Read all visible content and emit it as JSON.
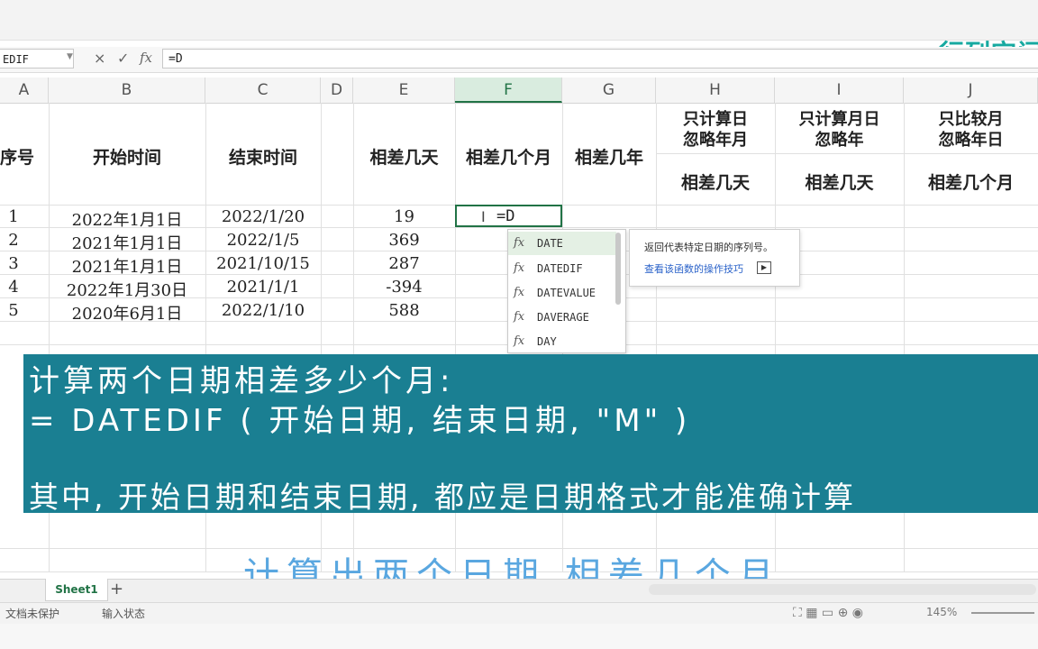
{
  "logo": {
    "text": "行列空间"
  },
  "formula_bar": {
    "name_box": "EDIF",
    "cancel_icon": "×",
    "confirm_icon": "✓",
    "fx_label": "fx",
    "formula": "=D"
  },
  "columns": [
    "A",
    "B",
    "C",
    "D",
    "E",
    "F",
    "G",
    "H",
    "I",
    "J"
  ],
  "selected_column": "F",
  "headers": {
    "A": "序号",
    "B": "开始时间",
    "C": "结束时间",
    "E": "相差几天",
    "F": "相差几个月",
    "G": "相差几年",
    "H_top": "只计算日\n忽略年月",
    "I_top": "只计算月日\n忽略年",
    "J_top": "只比较月\n忽略年日",
    "H_bottom": "相差几天",
    "I_bottom": "相差几天",
    "J_bottom": "相差几个月"
  },
  "rows": [
    {
      "A": "1",
      "B": "2022年1月1日",
      "C": "2022/1/20",
      "E": "19"
    },
    {
      "A": "2",
      "B": "2021年1月1日",
      "C": "2022/1/5",
      "E": "369"
    },
    {
      "A": "3",
      "B": "2021年1月1日",
      "C": "2021/10/15",
      "E": "287"
    },
    {
      "A": "4",
      "B": "2022年1月30日",
      "C": "2021/1/1",
      "E": "-394"
    },
    {
      "A": "5",
      "B": "2020年6月1日",
      "C": "2022/1/10",
      "E": "588"
    }
  ],
  "active_cell": {
    "text": "=D"
  },
  "autocomplete": {
    "items": [
      "DATE",
      "DATEDIF",
      "DATEVALUE",
      "DAVERAGE",
      "DAY"
    ],
    "selected_index": 0,
    "tooltip": {
      "description": "返回代表特定日期的序列号。",
      "link": "查看该函数的操作技巧"
    }
  },
  "overlay": {
    "background": "#1a7f92",
    "line1": "计算两个日期相差多少个月:",
    "line2": "= DATEDIF ( 开始日期, 结束日期, \"M\" )",
    "line3": "其中, 开始日期和结束日期, 都应是日期格式才能准确计算"
  },
  "subtitle": "计算出两个日期 相差几个月",
  "sheet_tabs": {
    "active": "Sheet1",
    "add": "+"
  },
  "status_bar": {
    "protect": "文档未保护",
    "mode": "输入状态",
    "zoom": "145%"
  }
}
